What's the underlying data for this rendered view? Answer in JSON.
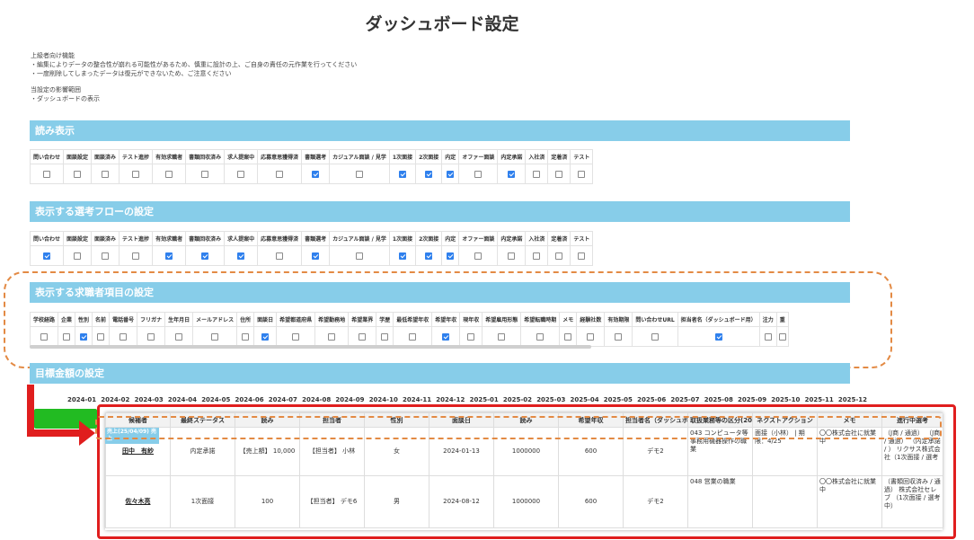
{
  "title": "ダッシュボード設定",
  "notice": {
    "heading": "上級者向け機能",
    "lines": [
      "・編集によりデータの整合性が崩れる可能性があるため、慎重に設計の上、ご自身の責任の元作業を行ってください",
      "・一度削除してしまったデータは復元ができないため、ご注意ください"
    ]
  },
  "scope": {
    "heading": "当設定の影響範囲",
    "item": "・ダッシュボードの表示"
  },
  "sections": {
    "yomi": {
      "title": "読み表示",
      "columns": [
        "問い合わせ",
        "面談設定",
        "面談済み",
        "テスト進捗",
        "有効求職者",
        "書類回収済み",
        "求人提案中",
        "応募意思獲得済",
        "書類選考",
        "カジュアル面談 / 見学",
        "1次面接",
        "2次面接",
        "内定",
        "オファー面談",
        "内定承諾",
        "入社済",
        "定着済",
        "テスト"
      ],
      "checked": [
        false,
        false,
        false,
        false,
        false,
        false,
        false,
        false,
        true,
        false,
        true,
        true,
        true,
        false,
        true,
        false,
        false,
        false
      ]
    },
    "flow": {
      "title": "表示する選考フローの設定",
      "columns": [
        "問い合わせ",
        "面談設定",
        "面談済み",
        "テスト進捗",
        "有効求職者",
        "書類回収済み",
        "求人提案中",
        "応募意思獲得済",
        "書類選考",
        "カジュアル面談 / 見学",
        "1次面接",
        "2次面接",
        "内定",
        "オファー面談",
        "内定承諾",
        "入社済",
        "定着済",
        "テスト"
      ],
      "checked": [
        true,
        false,
        false,
        false,
        true,
        true,
        true,
        false,
        true,
        false,
        true,
        true,
        true,
        false,
        false,
        false,
        false,
        false
      ]
    },
    "seeker": {
      "title": "表示する求職者項目の設定",
      "columns": [
        "学校経路",
        "企業",
        "性別",
        "名前",
        "電話番号",
        "フリガナ",
        "生年月日",
        "メールアドレス",
        "住所",
        "面談日",
        "希望都道府県",
        "希望勤務地",
        "希望業界",
        "学歴",
        "最低希望年収",
        "希望年収",
        "現年収",
        "希望雇用形態",
        "希望転職時期",
        "メモ",
        "経験社数",
        "有効期限",
        "問い合わせURL",
        "担当者名（ダッシュボード用）",
        "注力",
        "重"
      ],
      "checked": [
        false,
        false,
        true,
        false,
        false,
        false,
        false,
        false,
        false,
        true,
        false,
        false,
        false,
        false,
        false,
        true,
        false,
        false,
        false,
        false,
        false,
        false,
        false,
        true,
        false,
        false
      ]
    },
    "target": {
      "title": "目標金額の設定"
    }
  },
  "months": [
    "2024-01",
    "2024-02",
    "2024-03",
    "2024-04",
    "2024-05",
    "2024-06",
    "2024-07",
    "2024-08",
    "2024-09",
    "2024-10",
    "2024-11",
    "2024-12",
    "2025-01",
    "2025-02",
    "2025-03",
    "2025-04",
    "2025-05",
    "2025-06",
    "2025-07",
    "2025-08",
    "2025-09",
    "2025-10",
    "2025-11",
    "2025-12"
  ],
  "popup": {
    "badge": "売上(25/04/09) 売上",
    "headers": [
      "候補者",
      "最終ステータス",
      "読み",
      "担当者",
      "性別",
      "面談日",
      "読み",
      "希望年収",
      "担当者名（ダッシュボード用）",
      "取扱業務等の区分(2022)",
      "ネクストアクション",
      "メモ",
      "進行中選考"
    ],
    "rows": [
      {
        "name": "田中　有紗",
        "status": "内定承諾",
        "yomi": "【売上額】 10,000",
        "owner": "【担当者】 小林",
        "gender": "女",
        "date": "2024-01-13",
        "yomi2": "1000000",
        "salary": "600",
        "dash_owner": "デモ2",
        "category": "043 コンピュータ等事務用機器操作の職業",
        "next": "面接（小林） | 期限：4/25",
        "memo": "〇〇株式会社に就業中",
        "progress": "（J商 / 通過） （J商 / 通過） （内定承諾 / ） リクサス株式会社（1次面接 / 選考"
      },
      {
        "name": "佐々木亮",
        "status": "1次面接",
        "yomi": "100",
        "owner": "【担当者】 デモ6",
        "gender": "男",
        "date": "2024-08-12",
        "yomi2": "1000000",
        "salary": "600",
        "dash_owner": "デモ2",
        "category": "048 営業の職業",
        "next": "",
        "memo": "〇〇株式会社に就業中",
        "progress": "（書類回収済み / 通過） 株式会社セレブ （1次面接 / 選考中）"
      }
    ]
  },
  "colors": {
    "section_header": "#87cde9",
    "checkbox_on": "#2f80ed",
    "highlight_red": "#e01e1e",
    "highlight_orange": "#e38a44",
    "green_bar": "#22bb22"
  }
}
